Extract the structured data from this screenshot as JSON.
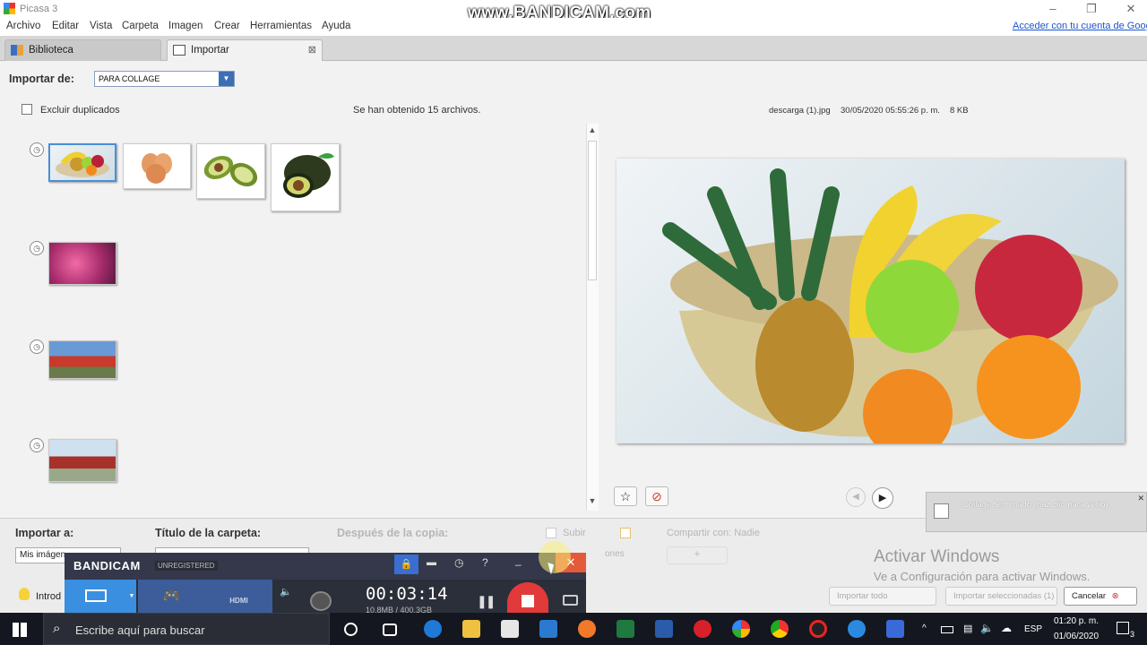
{
  "app": {
    "title": "Picasa 3"
  },
  "watermark": "www.BANDICAM.com",
  "window_controls": {
    "minimize": "–",
    "maximize": "❐",
    "close": "✕"
  },
  "menu": [
    "Archivo",
    "Editar",
    "Vista",
    "Carpeta",
    "Imagen",
    "Crear",
    "Herramientas",
    "Ayuda"
  ],
  "account_link": "Acceder con tu cuenta de Google",
  "tabs": [
    {
      "label": "Biblioteca"
    },
    {
      "label": "Importar",
      "close": "⊠"
    }
  ],
  "import": {
    "from_label": "Importar de:",
    "from_value": "PARA COLLAGE",
    "exclude_duplicates": "Excluir duplicados",
    "files_found": "Se han obtenido 15 archivos.",
    "file_name": "descarga (1).jpg",
    "file_date": "30/05/2020 05:55:26 p. m.",
    "file_size": "8 KB"
  },
  "bottom": {
    "import_to_label": "Importar a:",
    "import_to_value": "Mis imágen",
    "folder_title_label": "Título de la carpeta:",
    "after_copy_label": "Después de la copia:",
    "upload_label": "Subir",
    "share_label": "Compartir con: Nadie",
    "options_label": "ones",
    "intro_label": "Introd",
    "import_all": "Importar todo",
    "import_selected": "Importar seleccionadas (1)",
    "cancel": "Cancelar"
  },
  "notification": {
    "text": "Collage terminado (haz clic para verlo)",
    "close": "✕"
  },
  "activate": {
    "title": "Activar Windows",
    "subtitle": "Ve a Configuración para activar Windows."
  },
  "bandicam": {
    "brand": "BANDICAM",
    "badge": "UNREGISTERED",
    "timer": "00:03:14",
    "size": "10.8MB / 400.3GB",
    "hdmi": "HDMI",
    "help": "?"
  },
  "taskbar": {
    "search_placeholder": "Escribe aquí para buscar",
    "lang": "ESP",
    "time": "01:20 p. m.",
    "date": "01/06/2020",
    "notif_count": "3"
  }
}
